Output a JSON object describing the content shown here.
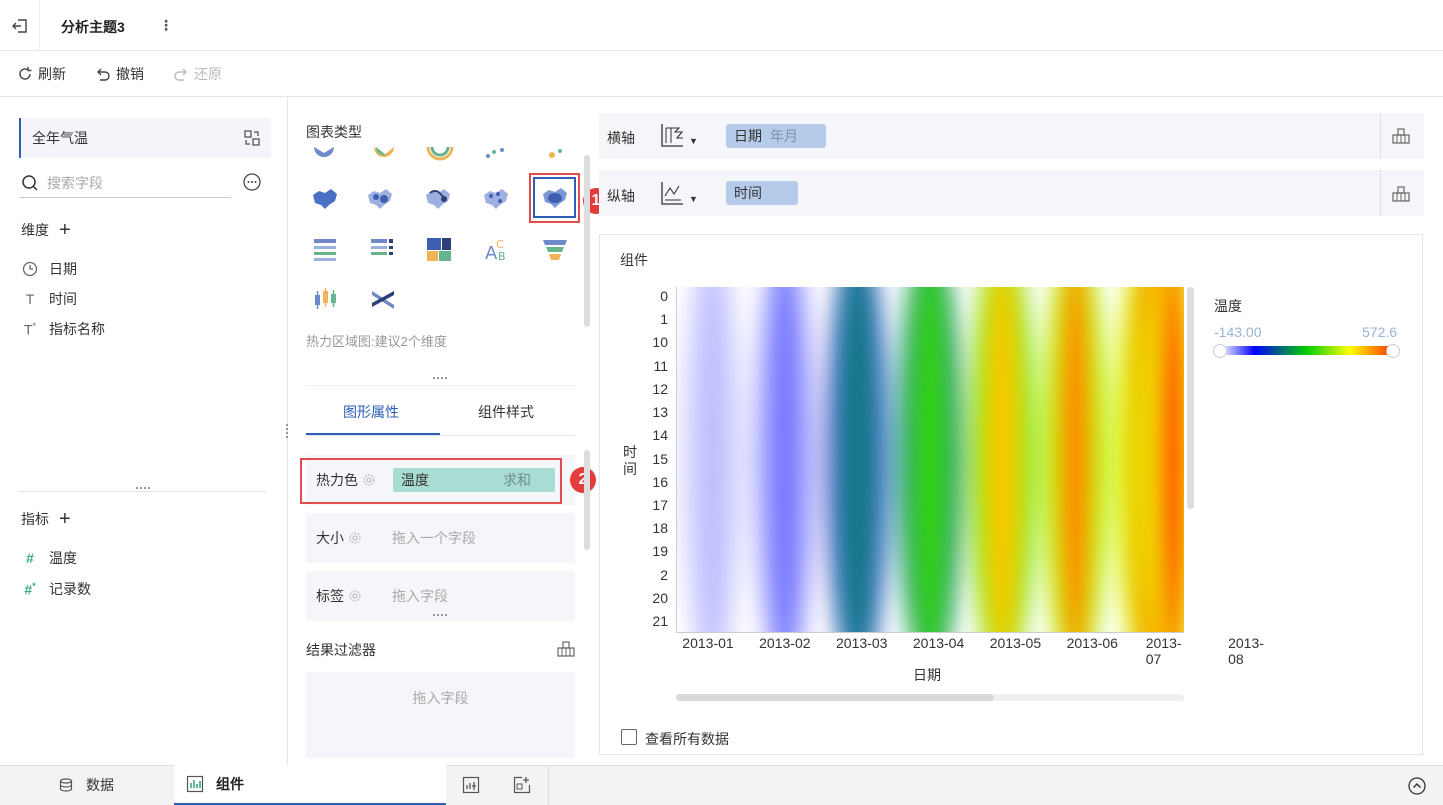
{
  "header": {
    "title": "分析主题3"
  },
  "toolbar": {
    "refresh": "刷新",
    "undo": "撤销",
    "redo": "还原"
  },
  "left": {
    "dataset": "全年气温",
    "search_placeholder": "搜索字段",
    "dimensions_title": "维度",
    "dimensions": [
      "日期",
      "时间",
      "指标名称"
    ],
    "measures_title": "指标",
    "measures": [
      "温度",
      "记录数"
    ]
  },
  "middle": {
    "chart_type_label": "图表类型",
    "chart_type_hint": "热力区域图:建议2个维度",
    "tabs": [
      "图形属性",
      "组件样式"
    ],
    "props": {
      "heat_label": "热力色",
      "heat_field": "温度",
      "heat_agg": "求和",
      "size_label": "大小",
      "size_placeholder": "拖入一个字段",
      "tag_label": "标签",
      "tag_placeholder": "拖入字段"
    },
    "filter_title": "结果过滤器",
    "filter_placeholder": "拖入字段",
    "badges": [
      "1",
      "2"
    ]
  },
  "axes": {
    "x_label": "横轴",
    "x_field": "日期",
    "x_sub": "年月",
    "y_label": "纵轴",
    "y_field": "时间"
  },
  "chart_card": {
    "title": "组件",
    "show_all_label": "查看所有数据"
  },
  "chart_data": {
    "type": "heatmap",
    "xlabel": "日期",
    "ylabel": "时间",
    "x": [
      "2013-01",
      "2013-02",
      "2013-03",
      "2013-04",
      "2013-05",
      "2013-06",
      "2013-07",
      "2013-08"
    ],
    "y": [
      "0",
      "1",
      "10",
      "11",
      "12",
      "13",
      "14",
      "15",
      "16",
      "17",
      "18",
      "19",
      "2",
      "20",
      "21"
    ],
    "legend_title": "温度",
    "legend_min": "-143.00",
    "legend_max": "572.6",
    "value_range": [
      -143.0,
      572.6
    ],
    "color_scale": [
      "#ffffff",
      "#0000ff",
      "#00cc00",
      "#ffff00",
      "#ff3300"
    ],
    "monthly_intensity": [
      0.08,
      0.15,
      0.38,
      0.55,
      0.82,
      0.9,
      0.95,
      0.97
    ]
  },
  "bottom": {
    "data_tab": "数据",
    "component_tab": "组件"
  }
}
